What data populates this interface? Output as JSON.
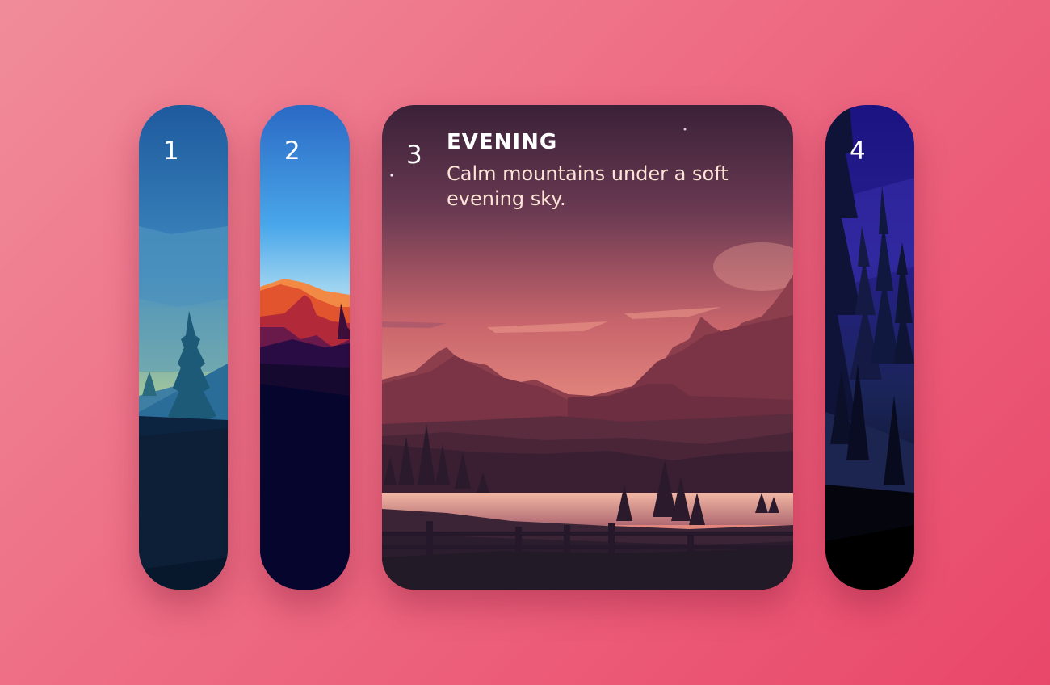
{
  "panels": [
    {
      "number": "1"
    },
    {
      "number": "2"
    },
    {
      "number": "3",
      "title": "EVENING",
      "description": "Calm mountains under a soft evening sky."
    },
    {
      "number": "4"
    }
  ]
}
